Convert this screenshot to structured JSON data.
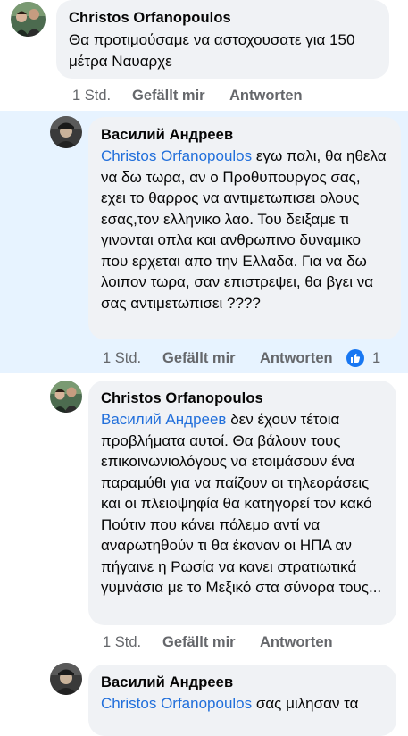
{
  "comments": [
    {
      "author": "Christos Orfanopoulos",
      "text": "Θα προτιμούσαμε να αστοχουσατε για 150 μέτρα  Ναυαρχε",
      "time": "1 Std.",
      "like_label": "Gefällt mir",
      "reply_label": "Antworten"
    },
    {
      "author": "Василий Андреев",
      "mention": "Christos Orfanopoulos",
      "text": " εγω παλι, θα ηθελα να δω τωρα, αν ο Προθυπουργος σας, εχει το θαρρος να αντιμετωπισει ολους εσας,τον ελληνικο λαο. Του δειξαμε τι γινονται οπλα και ανθρωπινο δυναμικο που ερχεται απο την Ελλαδα. Για να δω λοιπον τωρα, σαν επιστρεψει, θα βγει να σας αντιμετωπισει ????",
      "time": "1 Std.",
      "like_label": "Gefällt mir",
      "reply_label": "Antworten",
      "reaction_count": "1"
    },
    {
      "author": "Christos Orfanopoulos",
      "mention": "Василий Андреев",
      "text": " δεν έχουν τέτοια προβλήματα αυτοί.  Θα βάλουν τους επικοινωνιολόγους να ετοιμάσουν ένα παραμύθι για να παίζουν οι τηλεοράσεις και οι πλειοψηφία θα κατηγορεί τον κακό Πούτιν που κάνει πόλεμο αντί να αναρωτηθούν τι θα έκαναν οι ΗΠΑ αν πήγαινε η Ρωσία να κανει στρατιωτικά γυμνάσια με το Μεξικό στα σύνορα τους...",
      "time": "1 Std.",
      "like_label": "Gefällt mir",
      "reply_label": "Antworten"
    },
    {
      "author": "Василий Андреев",
      "mention": "Christos Orfanopoulos",
      "text": " σας μιλησαν τα"
    }
  ],
  "colors": {
    "mention": "#216fdb",
    "bubble": "#f0f2f5",
    "highlight": "#e7f3ff",
    "like": "#1877f2",
    "meta": "#65676b"
  }
}
